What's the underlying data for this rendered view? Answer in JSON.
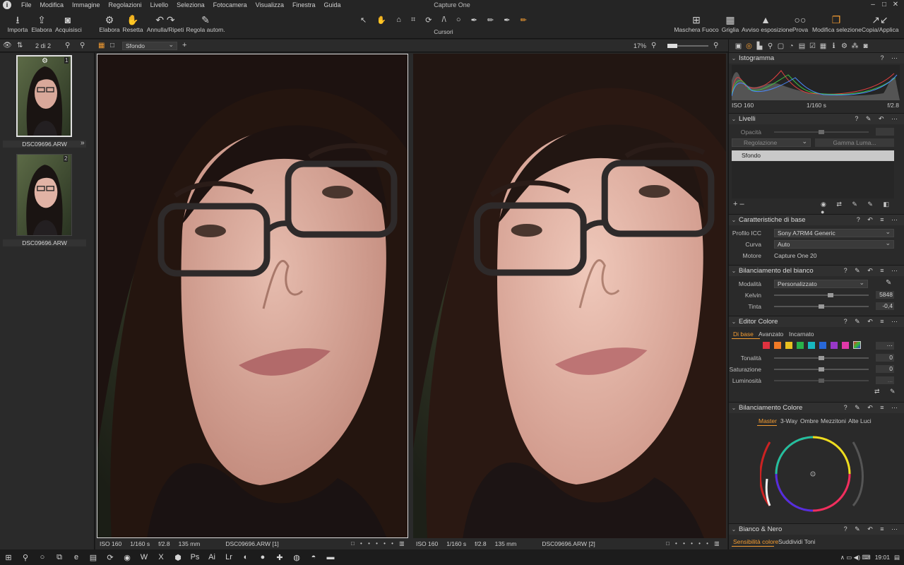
{
  "app": {
    "title": "Capture One"
  },
  "menu": [
    "File",
    "Modifica",
    "Immagine",
    "Regolazioni",
    "Livello",
    "Seleziona",
    "Fotocamera",
    "Visualizza",
    "Finestra",
    "Guida"
  ],
  "window_controls": [
    "–",
    "□",
    "✕"
  ],
  "toolbar": {
    "left": [
      {
        "icon": "⭳",
        "label": "Importa"
      },
      {
        "icon": "⇪",
        "label": "Elabora"
      },
      {
        "icon": "◙",
        "label": "Acquisisci"
      },
      {
        "icon": "⚙",
        "label": "Elabora"
      },
      {
        "icon": "✋",
        "label": "Resetta"
      },
      {
        "icon": "↶ ↷",
        "label": "Annulla/Ripeti"
      },
      {
        "icon": "✎",
        "label": "Regola autom."
      }
    ],
    "cursors_label": "Cursori",
    "cursor_icons": [
      "↖",
      "✋",
      "⌂",
      "⌗",
      "⟳",
      "/\\",
      "○",
      "✒",
      "✏",
      "✒",
      "✏"
    ],
    "right": [
      {
        "icon": "⊞",
        "label": "Maschera Fuoco"
      },
      {
        "icon": "▦",
        "label": "Griglia"
      },
      {
        "icon": "▲",
        "label": "Avviso esposizione"
      },
      {
        "icon": "○○",
        "label": "Prova"
      },
      {
        "icon": "❐",
        "label": "Modifica selezione"
      },
      {
        "icon": "↗↙",
        "label": "Copia/Applica"
      }
    ]
  },
  "secbar": {
    "counter": "2 di 2",
    "layer_select": "Sfondo",
    "zoom": "17%"
  },
  "browser": {
    "thumbs": [
      {
        "name": "DSC09696.ARW",
        "badge": "1"
      },
      {
        "name": "DSC09696.ARW",
        "badge": "2"
      }
    ]
  },
  "viewer": {
    "left": {
      "iso": "ISO 160",
      "shutter": "1/160 s",
      "aperture": "f/2.8",
      "focal": "135 mm",
      "file": "DSC09696.ARW [1]"
    },
    "right": {
      "iso": "ISO 160",
      "shutter": "1/160 s",
      "aperture": "f/2.8",
      "focal": "135 mm",
      "file": "DSC09696.ARW [2]"
    }
  },
  "panel": {
    "histogram": {
      "title": "Istogramma",
      "iso": "ISO 160",
      "shutter": "1/160 s",
      "aperture": "f/2.8"
    },
    "layers": {
      "title": "Livelli",
      "opacity_label": "Opacità",
      "adjust_select": "Regolazione",
      "gamma_btn": "Gamma Luma...",
      "layer_item": "Sfondo"
    },
    "basic": {
      "title": "Caratteristiche di base",
      "icc_label": "Profilo ICC",
      "icc_value": "Sony A7RM4 Generic",
      "curve_label": "Curva",
      "curve_value": "Auto",
      "engine_label": "Motore",
      "engine_value": "Capture One 20"
    },
    "wb": {
      "title": "Bilanciamento del bianco",
      "mode_label": "Modalità",
      "mode_value": "Personalizzato",
      "kelvin_label": "Kelvin",
      "kelvin_value": "5848",
      "kelvin_pos": 0.6,
      "tint_label": "Tinta",
      "tint_value": "-0,4",
      "tint_pos": 0.5
    },
    "color_editor": {
      "title": "Editor Colore",
      "tabs": [
        "Di base",
        "Avanzato",
        "Incarnato"
      ],
      "swatches": [
        "#e0323f",
        "#f07a26",
        "#e8c020",
        "#28b24a",
        "#18b8c0",
        "#2868d8",
        "#9838c8",
        "#e038a8"
      ],
      "hue_label": "Tonalità",
      "hue_value": "0",
      "sat_label": "Saturazione",
      "sat_value": "0",
      "lum_label": "Luminosità",
      "lum_value": "..."
    },
    "color_balance": {
      "title": "Bilanciamento Colore",
      "tabs": [
        "Master",
        "3-Way",
        "Ombre",
        "Mezzitoni",
        "Alte Luci"
      ]
    },
    "bw": {
      "title": "Bianco & Nero",
      "tabs": [
        "Sensibilità colore",
        "Suddividi Toni"
      ]
    }
  },
  "taskbar": {
    "time": "19:01",
    "icons": [
      "⊞",
      "⚲",
      "○",
      "⧉",
      "e",
      "▤",
      "⟳",
      "◉",
      "W",
      "X",
      "⬢",
      "Ps",
      "Ai",
      "Lr",
      "◐",
      "●",
      "✚",
      "◍",
      "◓",
      "▬"
    ]
  },
  "colors": {
    "accent": "#f39c32",
    "panel": "#2a2a2a",
    "header": "#303030",
    "bg": "#1e1e1e"
  }
}
